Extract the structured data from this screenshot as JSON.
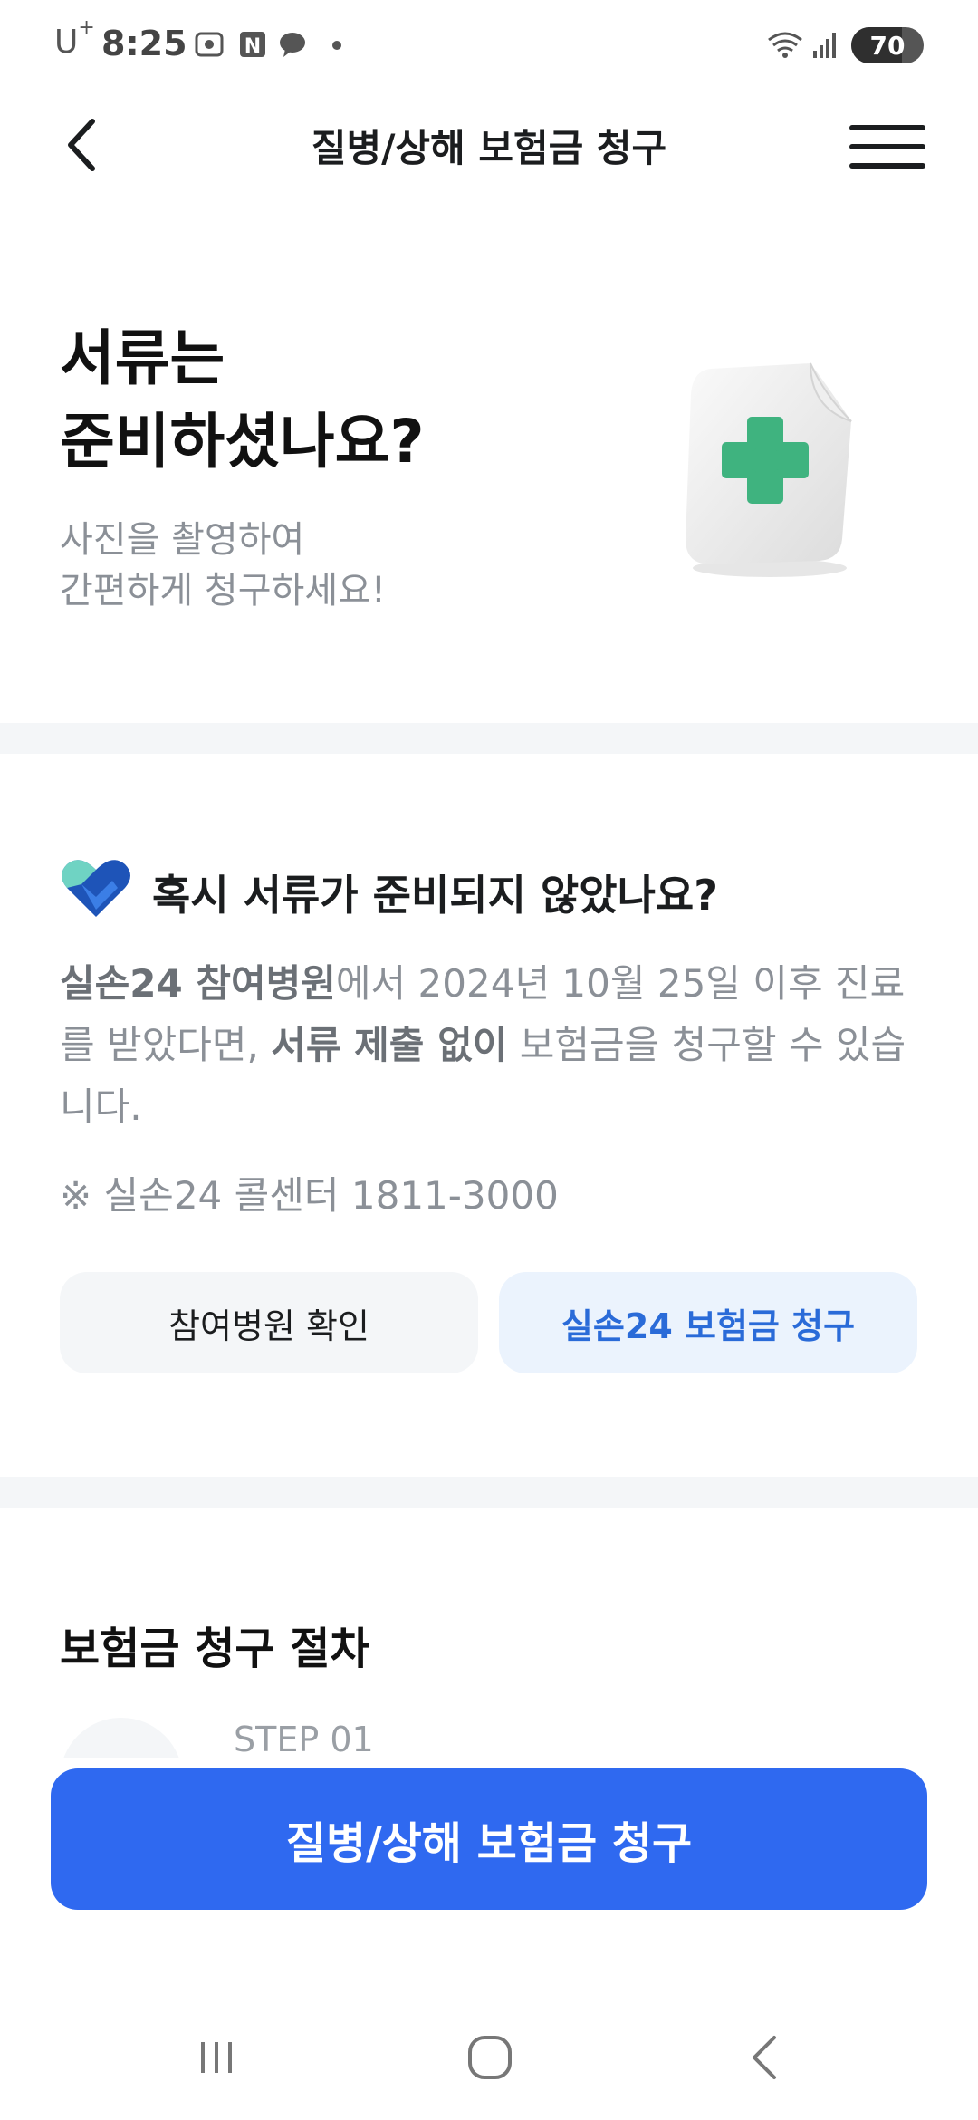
{
  "status_bar": {
    "carrier": "U",
    "carrier_sup": "+",
    "time": "8:25",
    "battery": "70",
    "battery_level": 0.7
  },
  "header": {
    "title": "질병/상해 보험금 청구"
  },
  "hero": {
    "title_line1": "서류는",
    "title_line2": "준비하셨나요?",
    "subtitle_line1": "사진을 촬영하여",
    "subtitle_line2": "간편하게 청구하세요!"
  },
  "info": {
    "title": "혹시 서류가 준비되지 않았나요?",
    "body_strong1": "실손24 참여병원",
    "body_text1": "에서 2024년 10월 25일 이후 진료를 받았다면, ",
    "body_strong2": "서류 제출 없이",
    "body_text2": " 보험금을 청구할 수 있습니다.",
    "note": "※ 실손24 콜센터 1811-3000",
    "button_hospitals": "참여병원 확인",
    "button_claim24": "실손24 보험금 청구"
  },
  "procedure": {
    "title": "보험금 청구 절차",
    "step_label": "STEP 01"
  },
  "cta": {
    "label": "질병/상해 보험금 청구"
  },
  "colors": {
    "primary": "#2f69f0",
    "secondary_bg": "#ebf3fd",
    "secondary_text": "#2a6bd8",
    "divider": "#f4f6f8",
    "green": "#3fb37f"
  },
  "icons": {
    "back": "chevron-left-icon",
    "menu": "hamburger-menu-icon",
    "document": "medical-document-icon",
    "heart": "heart-check-icon"
  }
}
